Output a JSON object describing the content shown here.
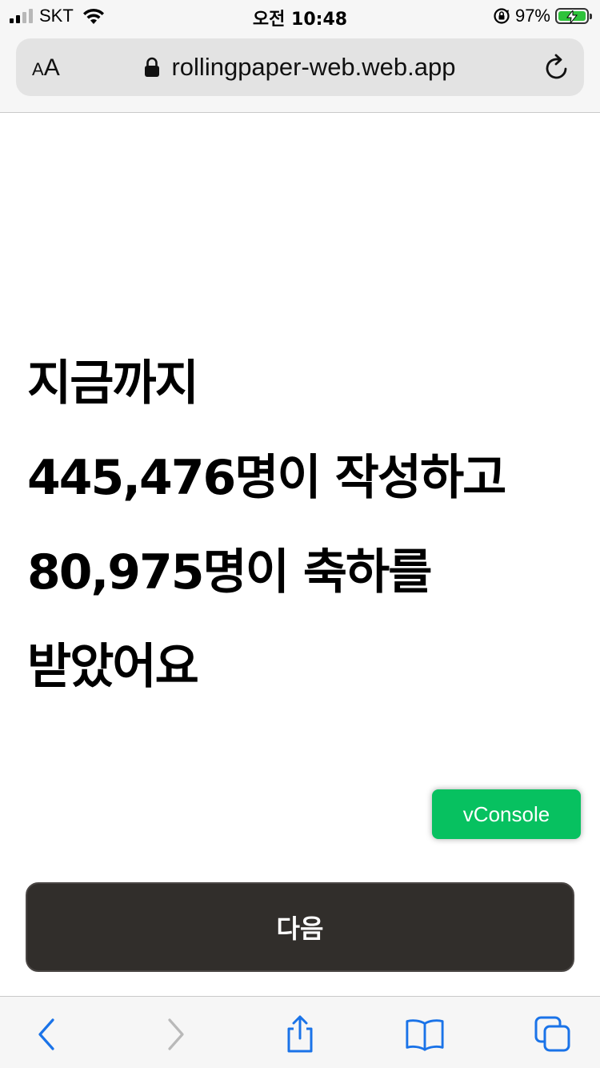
{
  "status_bar": {
    "carrier": "SKT",
    "time": "오전 10:48",
    "battery_percent": "97%",
    "icons": [
      "signal-icon",
      "wifi-icon",
      "orientation-lock-icon",
      "battery-charging-icon"
    ]
  },
  "browser": {
    "text_size_label_small": "A",
    "text_size_label_large": "A",
    "url": "rollingpaper-web.web.app",
    "icons": [
      "lock-icon",
      "reload-icon"
    ]
  },
  "main": {
    "headline_lines": [
      "지금까지",
      "445,476명이 작성하고",
      "80,975명이 축하를",
      "받았어요"
    ],
    "vconsole_label": "vConsole",
    "next_button_label": "다음"
  },
  "toolbar": {
    "icons": [
      "back-icon",
      "forward-icon",
      "share-icon",
      "bookmarks-icon",
      "tabs-icon"
    ]
  },
  "colors": {
    "accent_blue": "#1a73e8",
    "vconsole_green": "#07c160",
    "button_dark": "#312e2b",
    "battery_green": "#2fc23b"
  }
}
